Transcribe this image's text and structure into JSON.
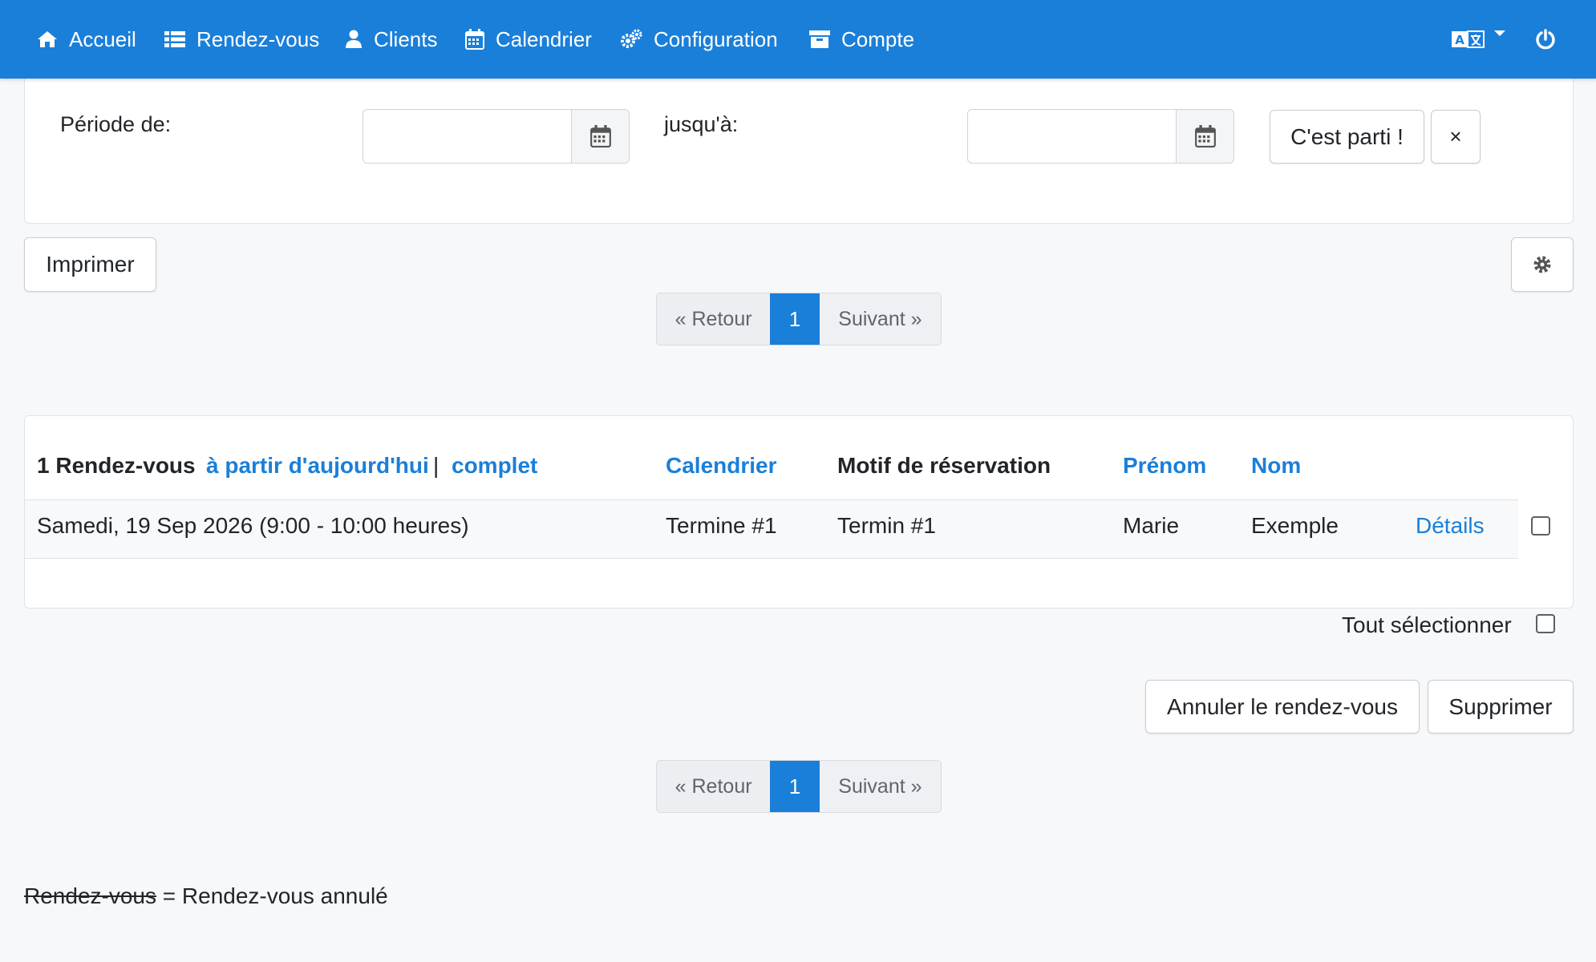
{
  "nav": {
    "items": [
      {
        "label": "Accueil",
        "icon": "home-icon"
      },
      {
        "label": "Rendez-vous",
        "icon": "list-icon"
      },
      {
        "label": "Clients",
        "icon": "user-icon"
      },
      {
        "label": "Calendrier",
        "icon": "calendar-icon"
      },
      {
        "label": "Configuration",
        "icon": "gears-icon"
      },
      {
        "label": "Compte",
        "icon": "archive-icon"
      }
    ],
    "language_icon": "translate-icon",
    "logout_icon": "power-icon"
  },
  "filter": {
    "period_from_label": "Période de:",
    "period_from_value": "",
    "period_to_label": "jusqu'à:",
    "period_to_value": "",
    "go_label": "C'est parti !",
    "clear_label": "×"
  },
  "toolbar": {
    "print_label": "Imprimer",
    "settings_icon": "gear-icon"
  },
  "pagination": {
    "prev_label": "« Retour",
    "current_page": "1",
    "next_label": "Suivant »"
  },
  "appointments": {
    "count_label": "1 Rendez-vous",
    "filter_today_label": "à partir d'aujourd'hui",
    "separator": "|",
    "filter_all_label": "complet",
    "columns": {
      "calendar": "Calendrier",
      "reason": "Motif de réservation",
      "firstname": "Prénom",
      "lastname": "Nom"
    },
    "rows": [
      {
        "date": "Samedi, 19 Sep 2026 (9:00 - 10:00 heures)",
        "calendar": "Termine #1",
        "reason": "Termin #1",
        "firstname": "Marie",
        "lastname": "Exemple",
        "details_label": "Détails"
      }
    ]
  },
  "bulk": {
    "select_all_label": "Tout sélectionner",
    "cancel_label": "Annuler le rendez-vous",
    "delete_label": "Supprimer"
  },
  "legend": {
    "struck_text": "Rendez-vous",
    "meaning": " = Rendez-vous annulé"
  },
  "colors": {
    "primary": "#1a7fd9",
    "background": "#f7f8fa"
  }
}
